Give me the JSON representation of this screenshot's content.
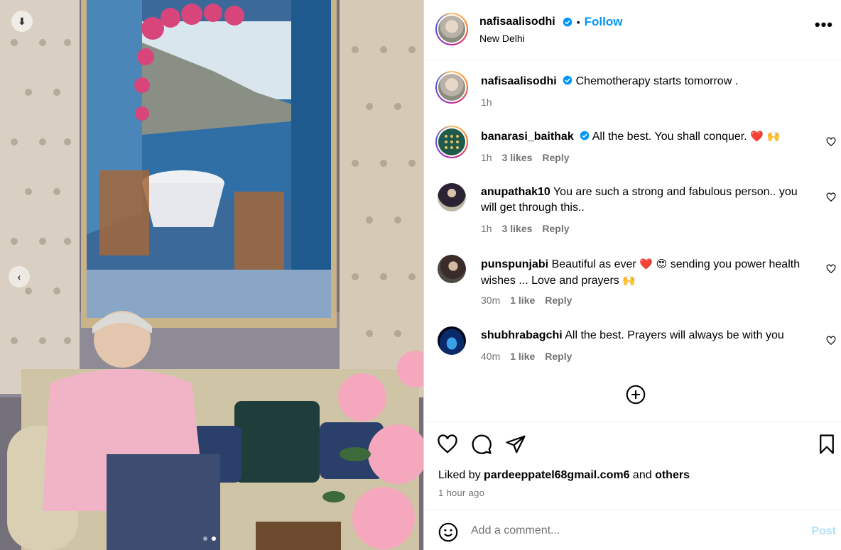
{
  "post": {
    "author": "nafisaalisodhi",
    "separator": "•",
    "follow_label": "Follow",
    "location": "New Delhi",
    "more_label": "•••"
  },
  "caption": {
    "username": "nafisaalisodhi",
    "text": "Chemotherapy starts tomorrow .",
    "time": "1h"
  },
  "comments": [
    {
      "username": "banarasi_baithak",
      "verified": true,
      "text": "All the best. You shall conquer.",
      "emoji": "❤️ 🙌",
      "time": "1h",
      "likes": "3 likes",
      "reply": "Reply"
    },
    {
      "username": "anupathak10",
      "text": "You are such a strong and fabulous person.. you will get through this..",
      "time": "1h",
      "likes": "3 likes",
      "reply": "Reply"
    },
    {
      "username": "punspunjabi",
      "text_before": "Beautiful as ever",
      "emoji_mid": "❤️ 😍",
      "text_after": "sending you power health wishes ... Love and prayers",
      "emoji_end": "🙌",
      "time": "30m",
      "likes": "1 like",
      "reply": "Reply"
    },
    {
      "username": "shubhrabagchi",
      "text": "All the best. Prayers will always be with you",
      "time": "40m",
      "likes": "1 like",
      "reply": "Reply"
    }
  ],
  "likes_summary": {
    "prefix": "Liked by",
    "user": "pardeeppatel68gmail.com6",
    "middle": "and",
    "others": "others"
  },
  "posted_ago": "1 hour ago",
  "composer": {
    "placeholder": "Add a comment...",
    "post_label": "Post"
  },
  "carousel": {
    "slide_count": 2,
    "active_index": 1
  },
  "icons": {
    "verified": "verified-badge-icon",
    "like": "heart-icon",
    "comment": "comment-bubble-icon",
    "share": "paper-plane-icon",
    "save": "bookmark-icon",
    "emoji": "smiley-icon",
    "load_more": "plus-circle-icon"
  },
  "colors": {
    "accent": "#0095f6",
    "muted": "#737373",
    "post_disabled": "#b2dffc",
    "verified": "#0095f6"
  }
}
